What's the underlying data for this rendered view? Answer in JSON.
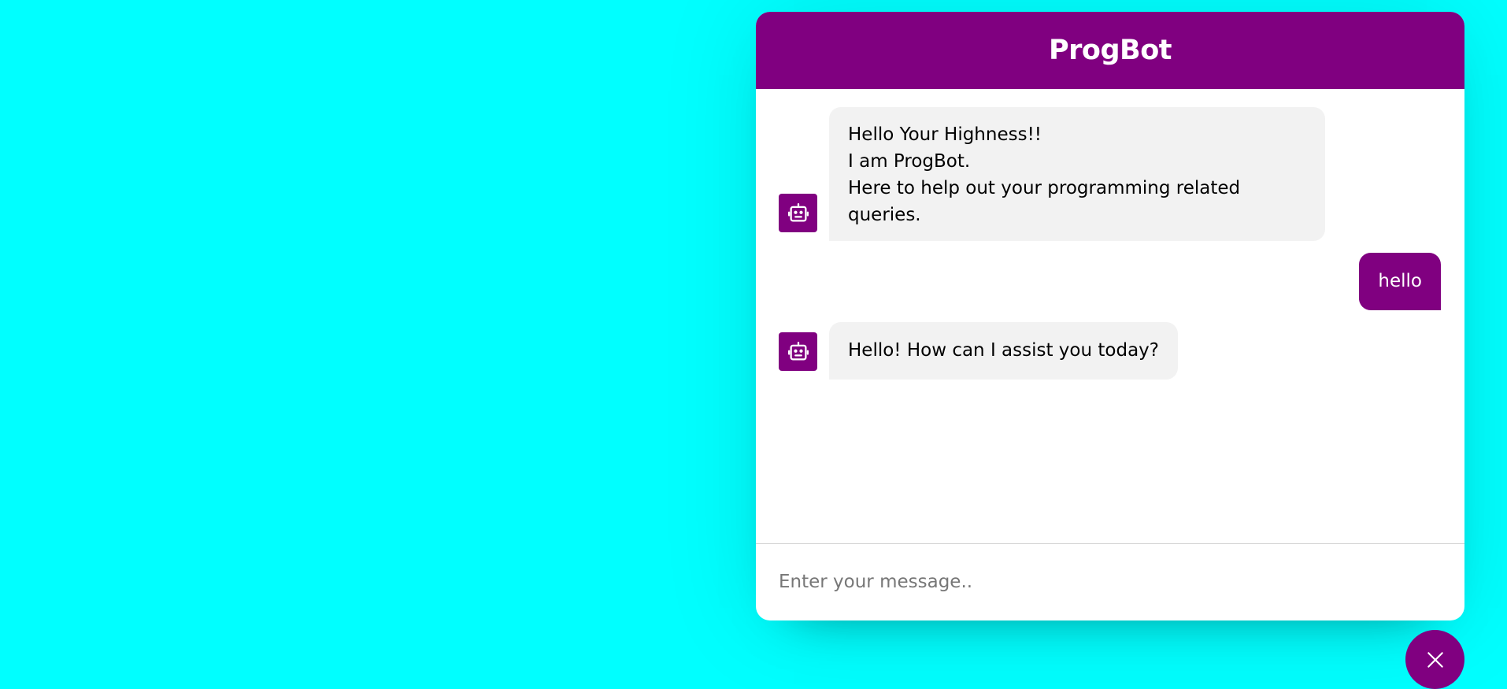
{
  "header": {
    "title": "ProgBot"
  },
  "messages": [
    {
      "from": "bot",
      "icon": "robot-icon",
      "text": "Hello Your Highness!!\nI am ProgBot.\nHere to help out your programming related\nqueries."
    },
    {
      "from": "user",
      "text": "hello"
    },
    {
      "from": "bot",
      "icon": "robot-icon",
      "text": "Hello! How can I assist you today?"
    }
  ],
  "input": {
    "placeholder": "Enter your message..",
    "value": ""
  },
  "toggler": {
    "icon": "close-icon"
  },
  "colors": {
    "background": "#00ffff",
    "accent": "#800080",
    "bubble": "#f2f2f2"
  }
}
